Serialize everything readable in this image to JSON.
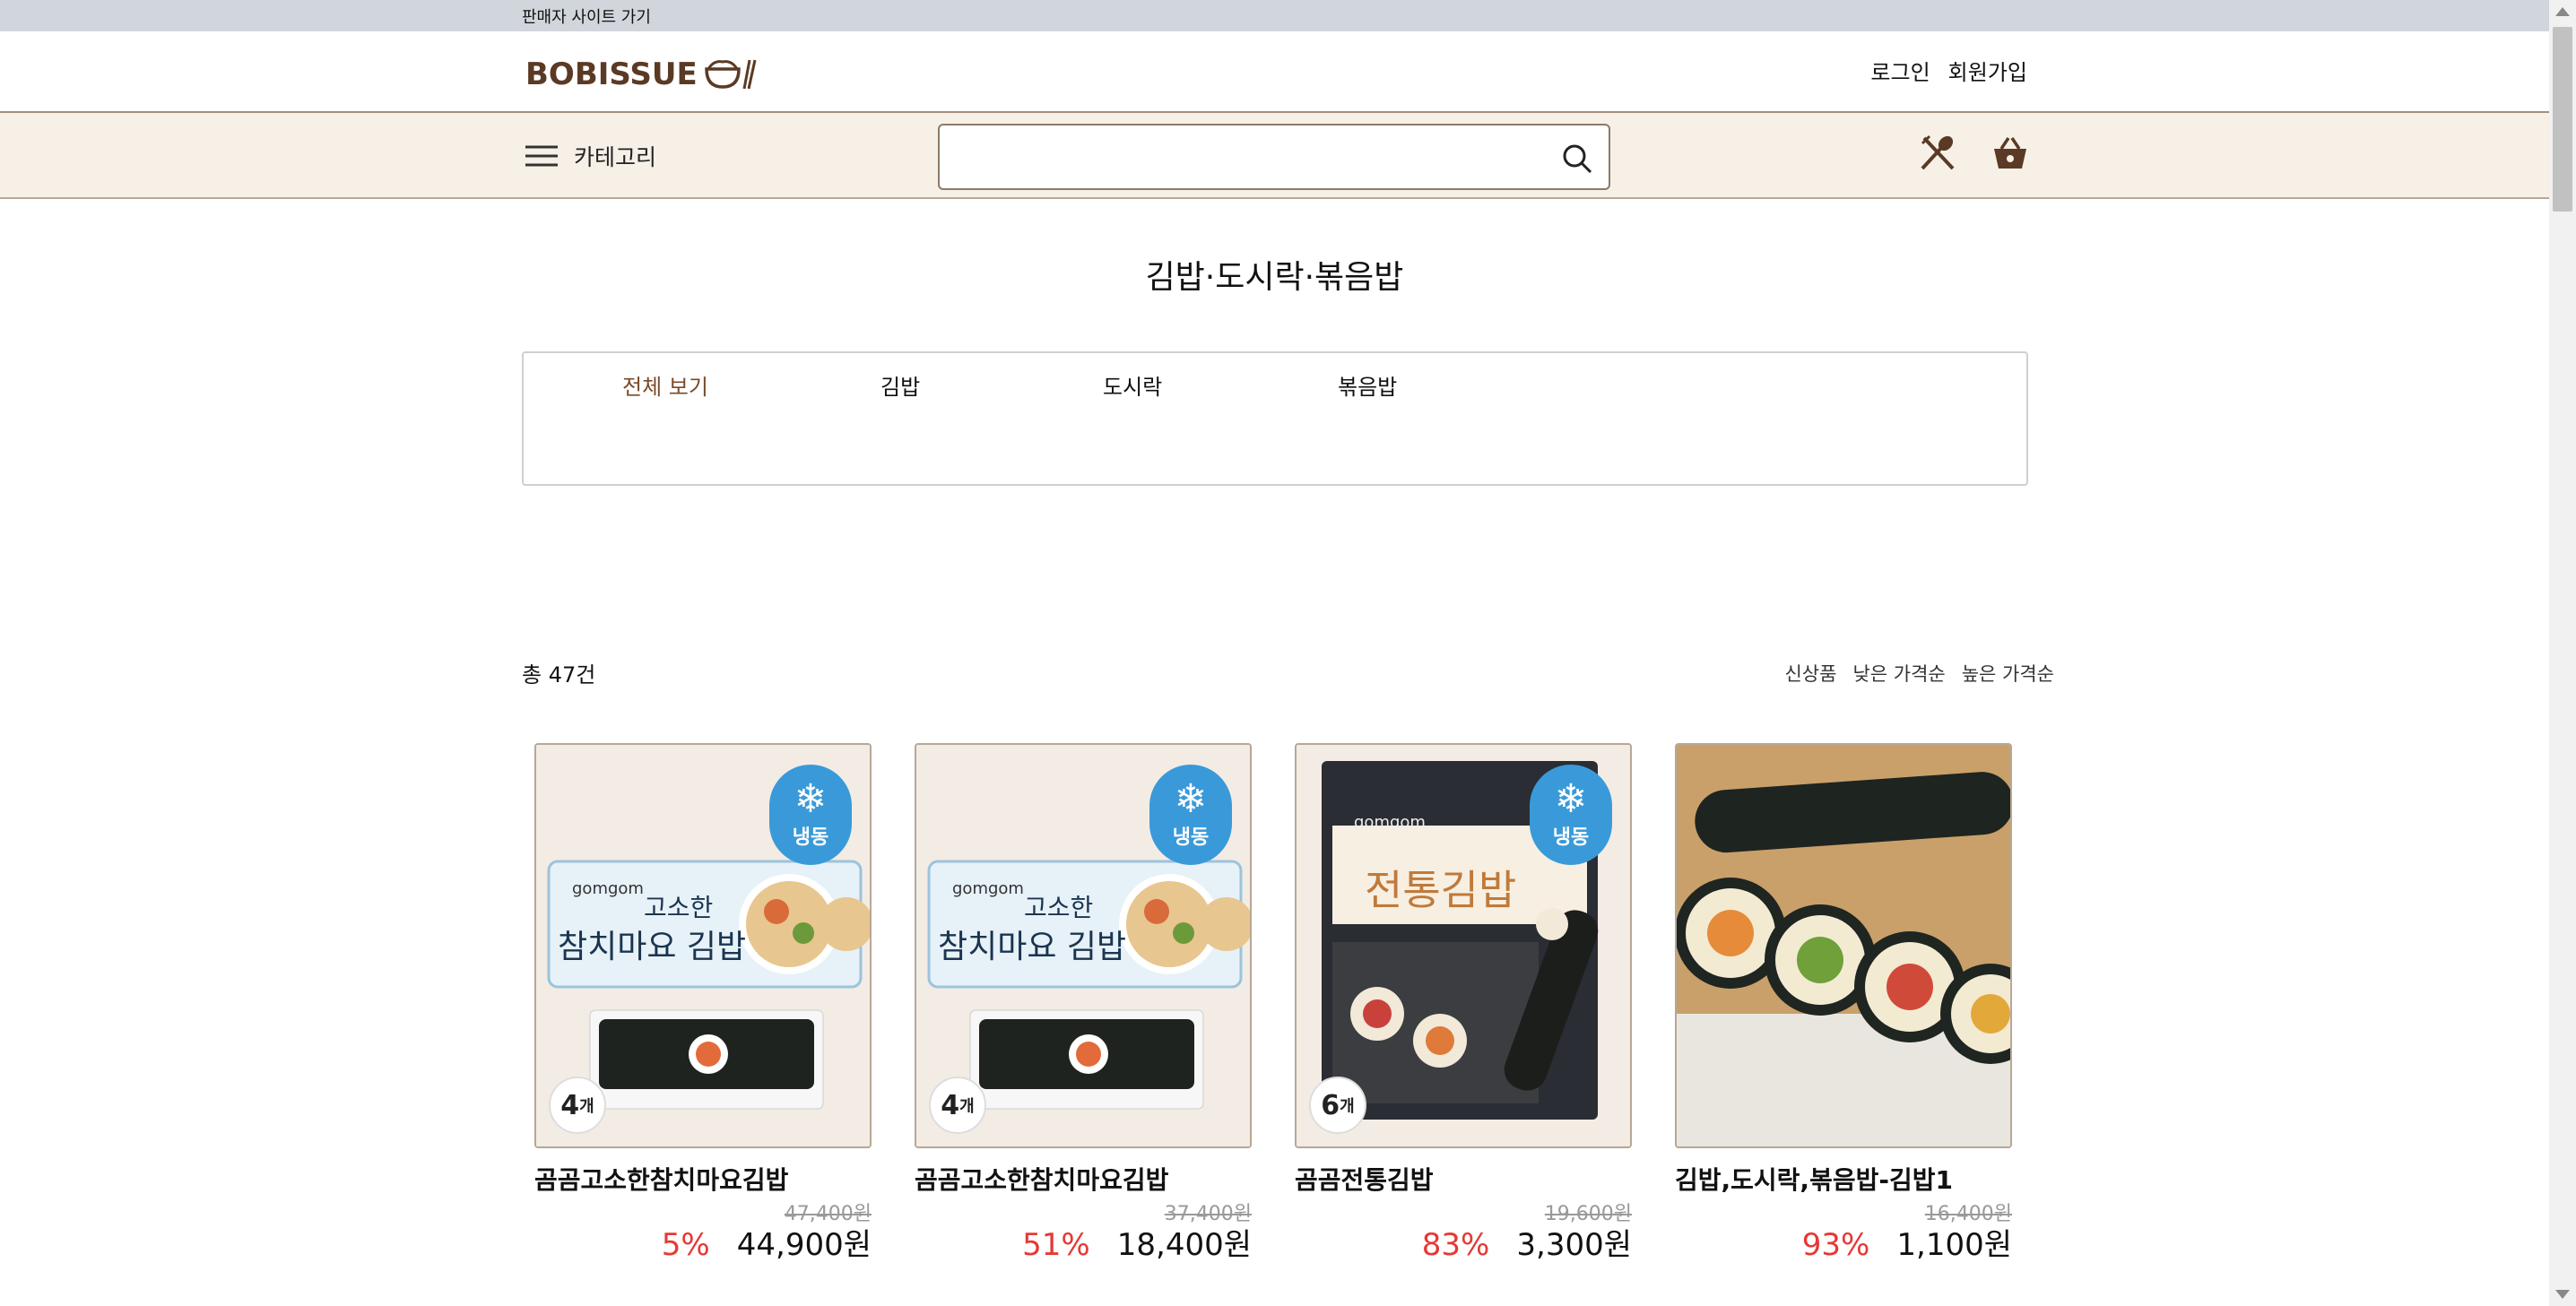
{
  "topbar": {
    "seller_link": "판매자 사이트 가기"
  },
  "header": {
    "logo_text": "BOBISSUE",
    "login": "로그인",
    "signup": "회원가입"
  },
  "navbar": {
    "category_label": "카테고리",
    "search_placeholder": ""
  },
  "page": {
    "title": "김밥·도시락·볶음밥"
  },
  "subcategories": [
    {
      "label": "전체 보기",
      "active": true
    },
    {
      "label": "김밥",
      "active": false
    },
    {
      "label": "도시락",
      "active": false
    },
    {
      "label": "볶음밥",
      "active": false
    }
  ],
  "listing": {
    "total_label": "총 47건",
    "sort_options": [
      "신상품",
      "낮은 가격순",
      "높은 가격순"
    ]
  },
  "products": [
    {
      "name": "곰곰고소한참치마요김밥",
      "original_price": "47,400원",
      "discount": "5%",
      "price": "44,900원",
      "frozen_label": "냉동",
      "count_num": "4",
      "count_unit": "개",
      "package_brand": "gomgom",
      "package_line1": "고소한",
      "package_line2": "참치마요 김밥"
    },
    {
      "name": "곰곰고소한참치마요김밥",
      "original_price": "37,400원",
      "discount": "51%",
      "price": "18,400원",
      "frozen_label": "냉동",
      "count_num": "4",
      "count_unit": "개",
      "package_brand": "gomgom",
      "package_line1": "고소한",
      "package_line2": "참치마요 김밥"
    },
    {
      "name": "곰곰전통김밥",
      "original_price": "19,600원",
      "discount": "83%",
      "price": "3,300원",
      "frozen_label": "냉동",
      "count_num": "6",
      "count_unit": "개",
      "package_brand": "gomgom",
      "package_line1": "전통김밥",
      "package_line2": ""
    },
    {
      "name": "김밥,도시락,볶음밥-김밥1",
      "original_price": "16,400원",
      "discount": "93%",
      "price": "1,100원"
    }
  ],
  "colors": {
    "accent_brown": "#7a4a28",
    "nav_bg": "#f7f0e6",
    "discount_red": "#e53935",
    "frozen_blue": "#3a9ad9"
  }
}
